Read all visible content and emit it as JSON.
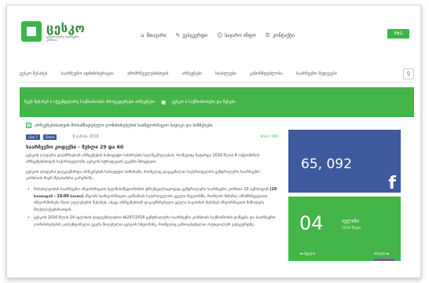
{
  "logo": {
    "name": "ცესკო",
    "sub": "ცენტრალური საარჩევნო კომისია"
  },
  "topnav": [
    {
      "icon": "home-icon",
      "glyph": "⌂",
      "label": "მთავარი"
    },
    {
      "icon": "wrench-icon",
      "glyph": "✎",
      "label": "ვებგვერდი"
    },
    {
      "icon": "people-icon",
      "glyph": "☺",
      "label": "საჯარო ინფო"
    },
    {
      "icon": "list-icon",
      "glyph": "☰",
      "label": "კონტაქტი"
    }
  ],
  "lang_button": "ENG",
  "mainnav": [
    "ცესკო შესახებ",
    "საარჩევნო ადმინისტრაცია",
    "ამომრჩევლებისთვის",
    "არჩევნები",
    "სიახლეები",
    "კანონმდებლობა",
    "საარჩევნო შედეგები"
  ],
  "banner": {
    "items": [
      "ჩვენ შესახებ ს იქვემდებარე საქმიანობის პროცედურები არჩევნები",
      "ცესკო-ს საქმიანობები და წესები"
    ]
  },
  "section_title": "არჩევნებისათვის მოსამზადებელი ღონისძიებების საინფორმაციო ბადაკი და ბიზნესები",
  "share": {
    "fb_like": "Like 7",
    "fb_share": "Share",
    "date": "9 ივნისი 2016",
    "print": "Print / PDF"
  },
  "article": {
    "title": "საარჩევნო კოდექსი - მუხლი 29 და 60",
    "p1": "ცესკოს ლიდერი დაესწრებიან არჩევნების საბიუჯეტო სახსრების ხელშეკრულებას, რომელიც ჩატარდა 2016 წლის 8 ოქტომბრის არჩევნებისთვის საქართველოში, ცესკოს სტრატეგიის გეგმის მიხედვით.",
    "p2": "ცესკოს ლიდერი დაუკავშირდა არჩევნების საბიუჯეტო სახსრებს, რომელიც დაგეგმილია საქართველოს ცენტრალური საარჩევნო კომისიის მიერ შესაბამისი გარემოში.",
    "list": [
      {
        "pre": "მოსახლეობის საარჩევნო ინფორმაციის ხელმისაწვდომობის უზრუნველსაყოფად ცენტრალური საარჩევნო კომისია 10 ივნისიდან ",
        "bold": "(10 საათიდან - 18:00 საათი)",
        "post": " აწყობს საინფორმაციო კამპანიას საქართველოს ყველა რეგიონში, რომლის მიზანია ამომრჩეველთა ინფორმირება მათი უფლებების შესახებ, ასევე არჩევნებთან დაკავშირებული ყველა საკითხის შესახებ ინფორმაციის მიწოდება მოქალაქეებისათვის."
      },
      {
        "pre": "ცესკოს 2016 წლის 14 ივლისის დადგენილებით №297/2016 ცენტრალური საარჩევნო კომისიის საქმიანობის დაწყება და საარჩევნო ღონისძიებების კალენდარული გეგმა მიღებულია ცესკოს სხდომაზე, რომელიც განთავსებულია ოფიციალურ ვებგვერდზე.",
        "bold": "",
        "post": ""
      }
    ]
  },
  "sidebar": {
    "fb_count": "65, 092",
    "fb_glyph": "f",
    "calendar": {
      "day": "04",
      "month": "ივლისი",
      "year": "2016 წელი",
      "prev": "◄ ძველი",
      "next": "ახალი ►"
    }
  }
}
